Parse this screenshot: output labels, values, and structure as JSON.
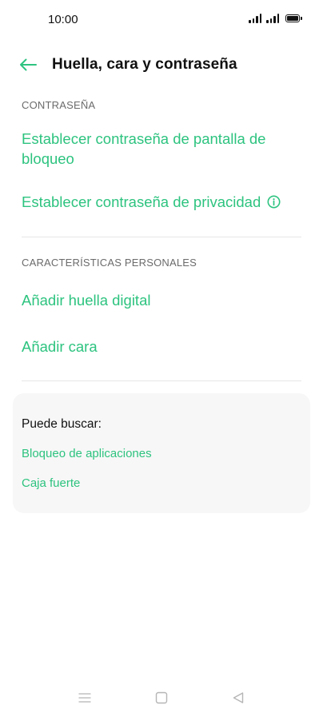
{
  "status_bar": {
    "time": "10:00"
  },
  "header": {
    "title": "Huella, cara y contraseña"
  },
  "sections": {
    "password": {
      "heading": "CONTRASEÑA",
      "lock_screen_label": "Establecer contraseña de pantalla de bloqueo",
      "privacy_label": "Establecer contraseña de privacidad"
    },
    "personal": {
      "heading": "CARACTERÍSTICAS PERSONALES",
      "fingerprint_label": "Añadir huella digital",
      "face_label": "Añadir cara"
    }
  },
  "suggestions": {
    "title": "Puede buscar:",
    "items": [
      "Bloqueo de aplicaciones",
      "Caja fuerte"
    ]
  },
  "colors": {
    "accent": "#2dc37f",
    "section_text": "#6b6b6b",
    "card_background": "#f7f7f7"
  },
  "icons": {
    "back": "arrow-left-icon",
    "info": "info-circle-icon",
    "nav_menu": "menu-lines-icon",
    "nav_home": "square-icon",
    "nav_back": "triangle-left-icon"
  }
}
